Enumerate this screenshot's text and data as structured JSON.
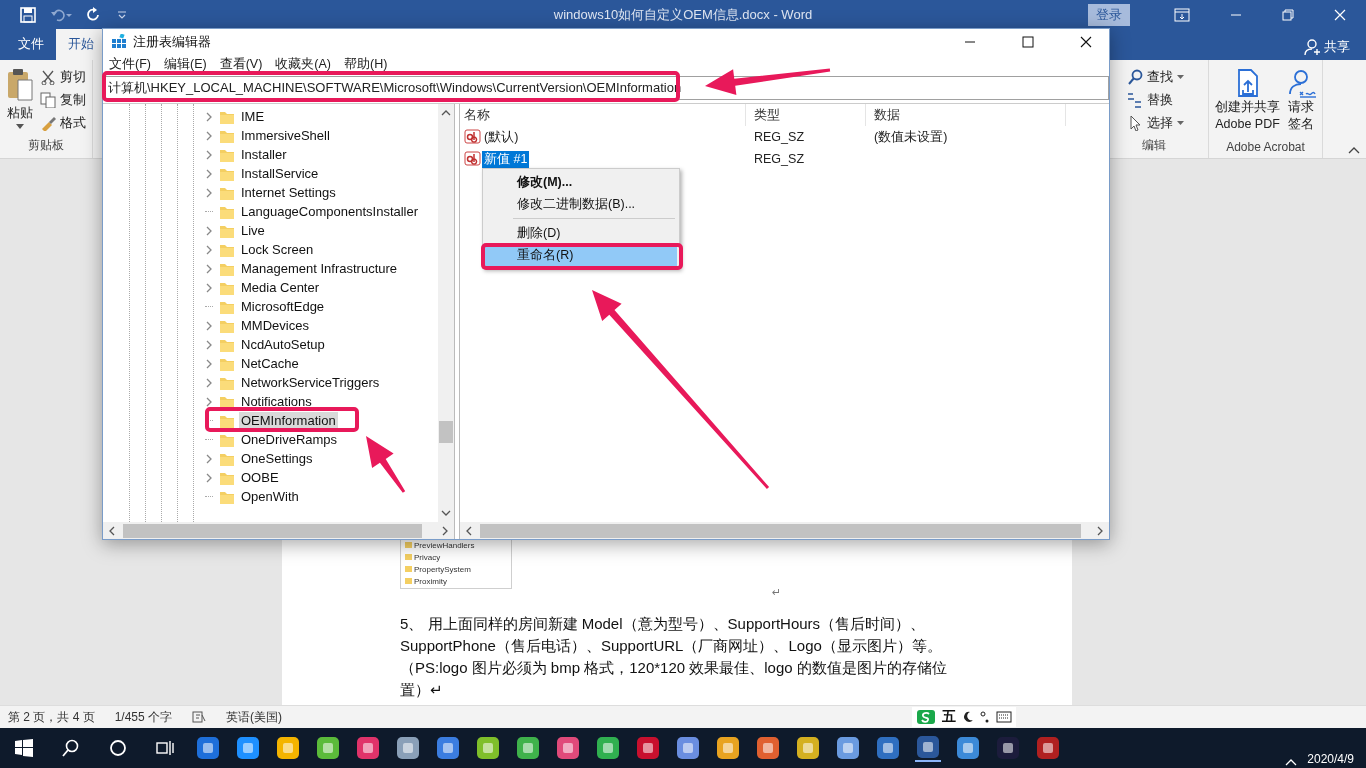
{
  "word": {
    "title": "windows10如何自定义OEM信息.docx  -  Word",
    "login": "登录",
    "share": "共享",
    "tabs": [
      {
        "label": "文件",
        "selected": false
      },
      {
        "label": "开始",
        "selected": true
      }
    ],
    "clipboard": {
      "paste": "粘贴",
      "items": [
        "剪切",
        "复制",
        "格式"
      ],
      "group": "剪贴板"
    },
    "editing": {
      "items": [
        {
          "label": "查找",
          "dropdown": true
        },
        {
          "label": "替换",
          "dropdown": false
        },
        {
          "label": "选择",
          "dropdown": true
        }
      ],
      "group": "编辑"
    },
    "acrobat": {
      "buttons": [
        {
          "lines": [
            "创建并共享",
            "Adobe PDF"
          ]
        },
        {
          "lines": [
            "请求",
            "签名"
          ]
        }
      ],
      "group": "Adobe Acrobat"
    }
  },
  "document": {
    "figure_items": [
      "PreviewHandlers",
      "Privacy",
      "PropertySystem",
      "Proximity"
    ],
    "figure_mark": "↵",
    "paragraph": "5、 用上面同样的房间新建 Model（意为型号）、SupportHours（售后时间）、SupportPhone（售后电话）、SupportURL（厂商网址）、Logo（显示图片）等。（PS:logo 图片必须为 bmp 格式，120*120 效果最佳、logo 的数值是图片的存储位置）↵"
  },
  "status_bar": {
    "page": "第 2 页，共 4 页",
    "words": "1/455 个字",
    "language": "英语(美国)",
    "ime": "五"
  },
  "taskbar": {
    "date": "2020/4/9"
  },
  "regedit": {
    "title": "注册表编辑器",
    "menu": [
      "文件(F)",
      "编辑(E)",
      "查看(V)",
      "收藏夹(A)",
      "帮助(H)"
    ],
    "address": "计算机\\HKEY_LOCAL_MACHINE\\SOFTWARE\\Microsoft\\Windows\\CurrentVersion\\OEMInformation",
    "tree": [
      {
        "label": "IME",
        "expandable": true,
        "selected": false
      },
      {
        "label": "ImmersiveShell",
        "expandable": true,
        "selected": false
      },
      {
        "label": "Installer",
        "expandable": true,
        "selected": false
      },
      {
        "label": "InstallService",
        "expandable": true,
        "selected": false
      },
      {
        "label": "Internet Settings",
        "expandable": true,
        "selected": false
      },
      {
        "label": "LanguageComponentsInstaller",
        "expandable": false,
        "selected": false
      },
      {
        "label": "Live",
        "expandable": true,
        "selected": false
      },
      {
        "label": "Lock Screen",
        "expandable": true,
        "selected": false
      },
      {
        "label": "Management Infrastructure",
        "expandable": true,
        "selected": false
      },
      {
        "label": "Media Center",
        "expandable": true,
        "selected": false
      },
      {
        "label": "MicrosoftEdge",
        "expandable": false,
        "selected": false
      },
      {
        "label": "MMDevices",
        "expandable": true,
        "selected": false
      },
      {
        "label": "NcdAutoSetup",
        "expandable": true,
        "selected": false
      },
      {
        "label": "NetCache",
        "expandable": true,
        "selected": false
      },
      {
        "label": "NetworkServiceTriggers",
        "expandable": true,
        "selected": false
      },
      {
        "label": "Notifications",
        "expandable": true,
        "selected": false
      },
      {
        "label": "OEMInformation",
        "expandable": false,
        "selected": true
      },
      {
        "label": "OneDriveRamps",
        "expandable": false,
        "selected": false
      },
      {
        "label": "OneSettings",
        "expandable": true,
        "selected": false
      },
      {
        "label": "OOBE",
        "expandable": true,
        "selected": false
      },
      {
        "label": "OpenWith",
        "expandable": false,
        "selected": false
      }
    ],
    "columns": [
      "名称",
      "类型",
      "数据"
    ],
    "values": [
      {
        "name": "(默认)",
        "type": "REG_SZ",
        "data": "(数值未设置)",
        "selected": false
      },
      {
        "name": "新值 #1",
        "type": "REG_SZ",
        "selected": true
      }
    ],
    "context_menu": [
      {
        "kind": "item",
        "label": "修改(M)...",
        "default": true,
        "selected": false
      },
      {
        "kind": "item",
        "label": "修改二进制数据(B)...",
        "default": false,
        "selected": false
      },
      {
        "kind": "separator"
      },
      {
        "kind": "item",
        "label": "删除(D)",
        "default": false,
        "selected": false
      },
      {
        "kind": "item",
        "label": "重命名(R)",
        "default": false,
        "selected": true
      }
    ]
  }
}
